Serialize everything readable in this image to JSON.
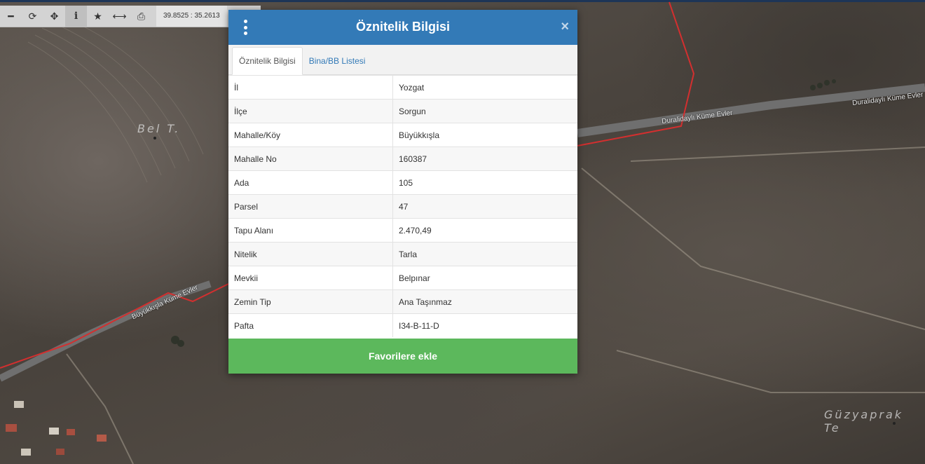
{
  "map": {
    "labels": {
      "hill_bel": "Bel T.",
      "hill_guzyaprak": "Güzyaprak Te",
      "road_durali_1": "Duralidaylı Küme Evler",
      "road_durali_2": "Duralidaylı Küme Evler",
      "road_buyukkisla": "Büyükkışla Küme Evler"
    },
    "parcel_boundary_color": "#d32f2f"
  },
  "toolbar": {
    "tools": [
      {
        "name": "zoom-out",
        "glyph": "━"
      },
      {
        "name": "refresh",
        "glyph": "⟳"
      },
      {
        "name": "locate",
        "glyph": "✥"
      },
      {
        "name": "info",
        "glyph": "i"
      },
      {
        "name": "favorites",
        "glyph": "★"
      },
      {
        "name": "measure",
        "glyph": "⟷"
      },
      {
        "name": "print",
        "glyph": "⎙"
      }
    ],
    "coordinates": "39.8525 : 35.2613"
  },
  "dialog": {
    "title": "Öznitelik Bilgisi",
    "close_glyph": "×",
    "tabs": [
      {
        "label": "Öznitelik Bilgisi",
        "active": true
      },
      {
        "label": "Bina/BB Listesi",
        "active": false
      }
    ],
    "rows": [
      {
        "key": "İl",
        "value": "Yozgat"
      },
      {
        "key": "İlçe",
        "value": "Sorgun"
      },
      {
        "key": "Mahalle/Köy",
        "value": "Büyükkışla"
      },
      {
        "key": "Mahalle No",
        "value": "160387"
      },
      {
        "key": "Ada",
        "value": "105"
      },
      {
        "key": "Parsel",
        "value": "47"
      },
      {
        "key": "Tapu Alanı",
        "value": "2.470,49"
      },
      {
        "key": "Nitelik",
        "value": "Tarla"
      },
      {
        "key": "Mevkii",
        "value": "Belpınar"
      },
      {
        "key": "Zemin Tip",
        "value": "Ana Taşınmaz"
      },
      {
        "key": "Pafta",
        "value": "I34-B-11-D"
      }
    ],
    "favorite_button": "Favorilere ekle",
    "colors": {
      "header": "#337ab7",
      "favorite_button": "#5cb85c"
    }
  }
}
